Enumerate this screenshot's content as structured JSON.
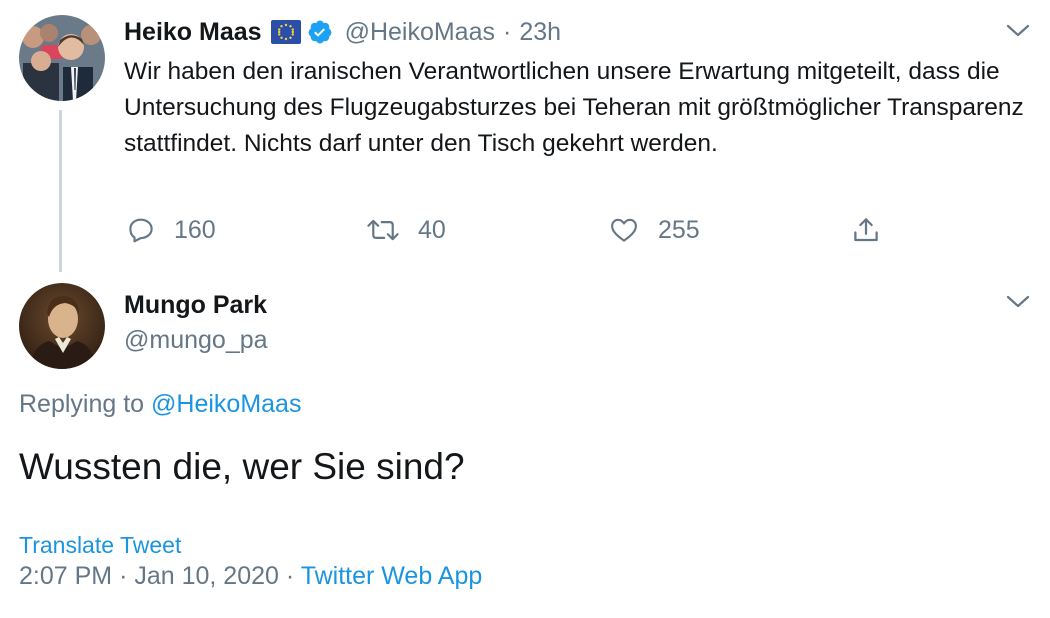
{
  "parent_tweet": {
    "author_name": "Heiko Maas",
    "handle": "@HeikoMaas",
    "separator": "·",
    "time_ago": "23h",
    "text": "Wir haben den iranischen Verantwortlichen unsere Erwartung mitgeteilt, dass die Untersuchung des Flugzeugabsturzes bei Teheran mit größtmöglicher Transparenz stattfindet. Nichts darf unter den Tisch gekehrt werden.",
    "replies": "160",
    "retweets": "40",
    "likes": "255",
    "badges": [
      "eu-flag-icon",
      "verified-icon"
    ]
  },
  "reply_tweet": {
    "author_name": "Mungo Park",
    "handle": "@mungo_pa",
    "replying_prefix": "Replying to",
    "replying_to": "@HeikoMaas",
    "text": "Wussten die, wer Sie sind?",
    "translate_label": "Translate Tweet",
    "time": "2:07 PM",
    "dot": "·",
    "date": "Jan 10, 2020",
    "source": "Twitter Web App"
  },
  "colors": {
    "text": "#14171a",
    "secondary": "#657786",
    "link": "#1b95e0",
    "verified": "#1da1f2",
    "thread_line": "#ccd6dd"
  }
}
